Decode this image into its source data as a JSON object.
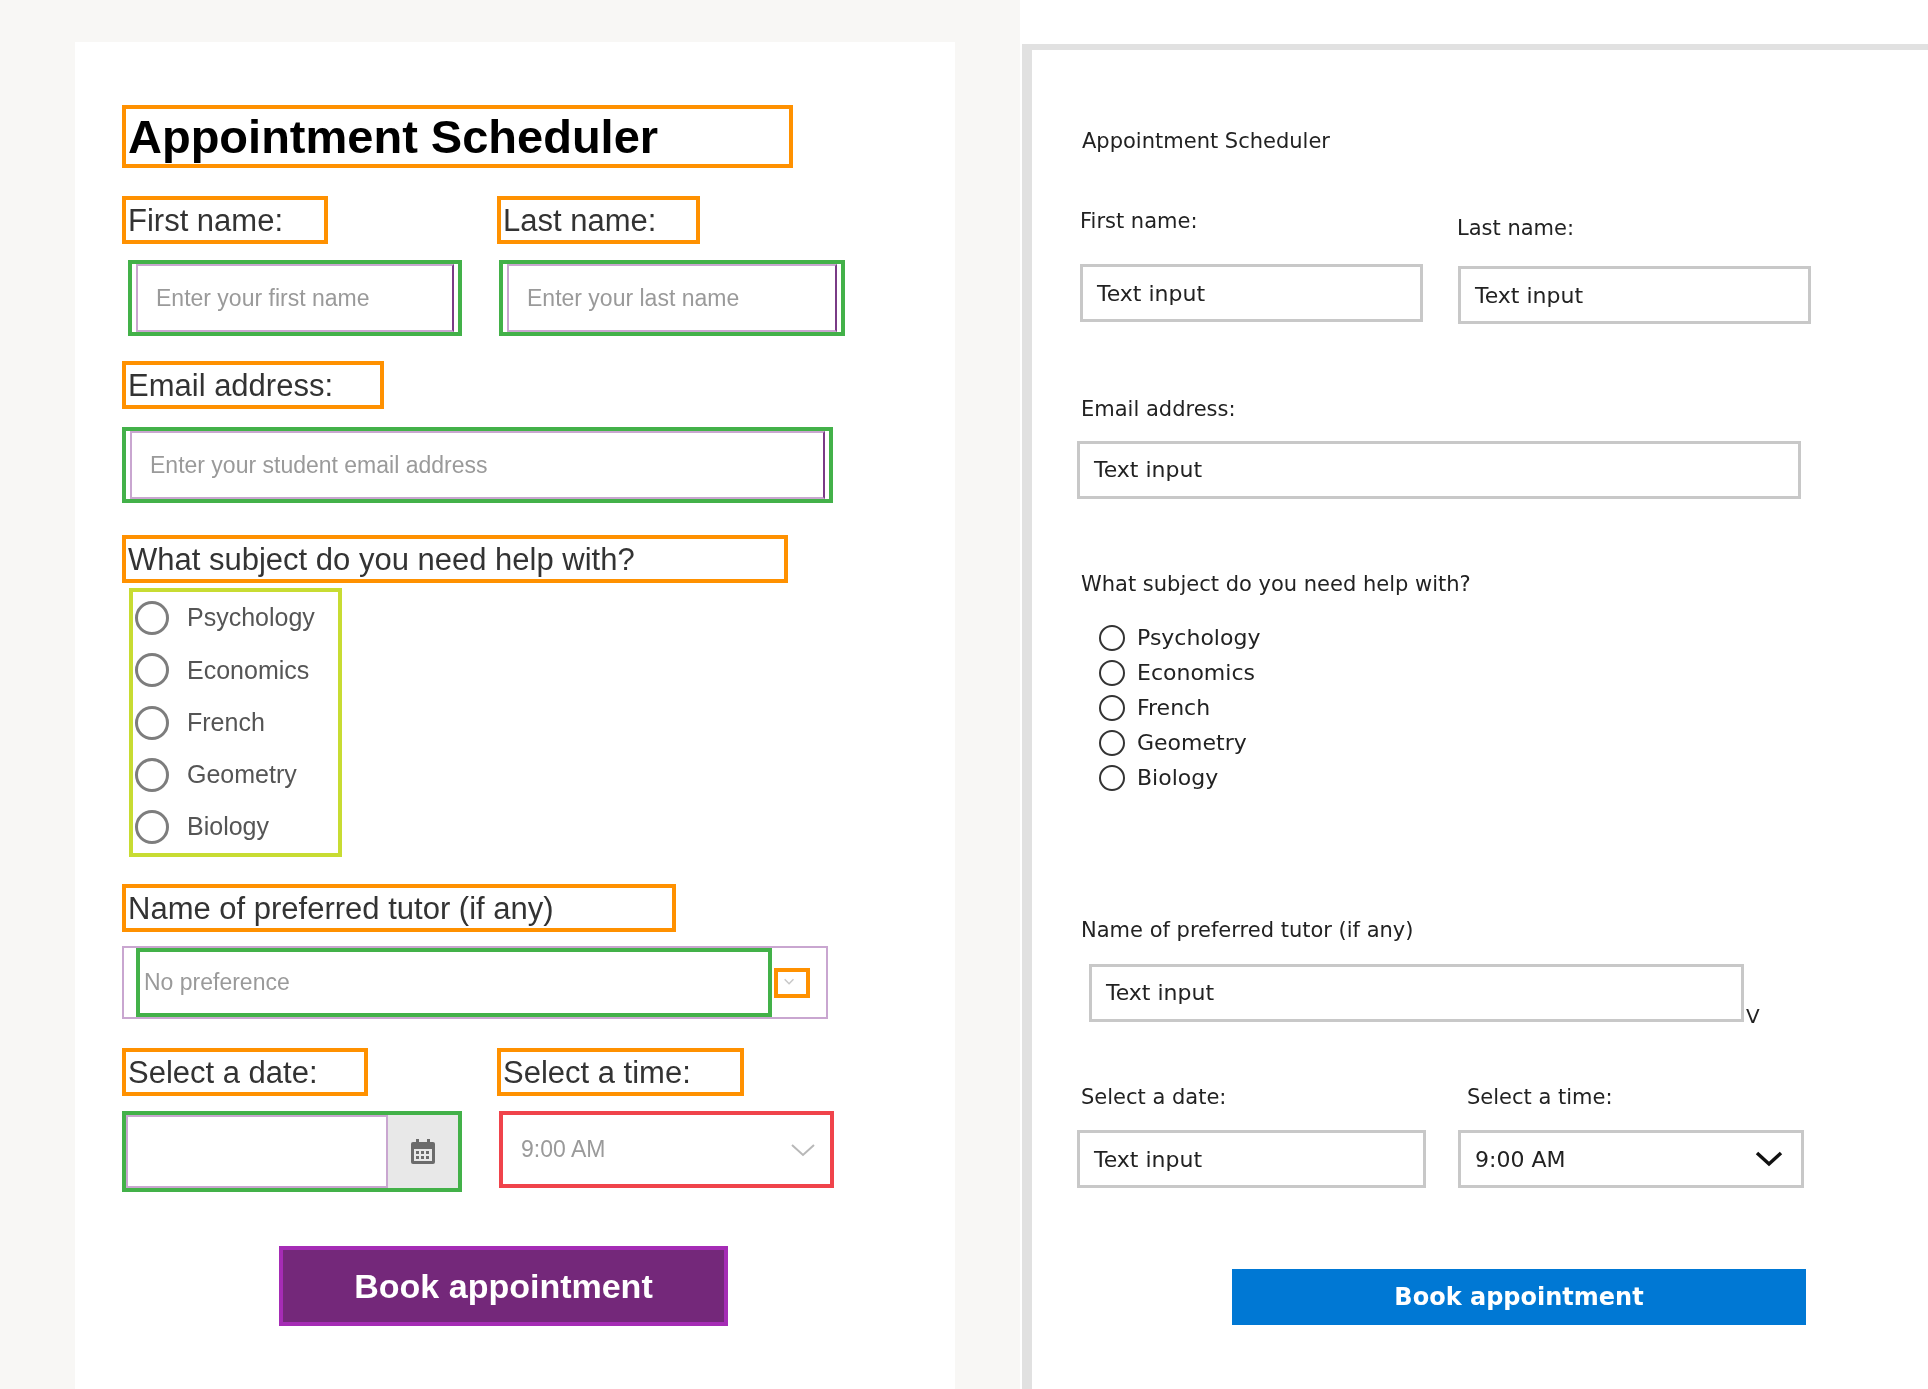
{
  "mockup": {
    "title": "Appointment Scheduler",
    "first_name": {
      "label": "First name:",
      "placeholder": "Enter your first name"
    },
    "last_name": {
      "label": "Last name:",
      "placeholder": "Enter your last name"
    },
    "email": {
      "label": "Email address:",
      "placeholder": "Enter your student email address"
    },
    "subject": {
      "question": "What subject do you need help with?",
      "options": [
        {
          "label": "Psychology",
          "selected": false
        },
        {
          "label": "Economics",
          "selected": false
        },
        {
          "label": "French",
          "selected": false
        },
        {
          "label": "Geometry",
          "selected": false
        },
        {
          "label": "Biology",
          "selected": false
        }
      ]
    },
    "tutor": {
      "label": "Name of preferred tutor (if any)",
      "placeholder": "No preference"
    },
    "date": {
      "label": "Select a date:"
    },
    "time": {
      "label": "Select a time:",
      "placeholder": "9:00 AM"
    },
    "button": "Book appointment"
  },
  "app_preview": {
    "title": "Appointment Scheduler",
    "first_name": {
      "label": "First name:",
      "value": "Text input"
    },
    "last_name": {
      "label": "Last name:",
      "value": "Text input"
    },
    "email": {
      "label": "Email address:",
      "value": "Text input"
    },
    "subject": {
      "question": "What subject do you need help with?",
      "options": [
        {
          "label": "Psychology",
          "selected": false
        },
        {
          "label": "Economics",
          "selected": false
        },
        {
          "label": "French",
          "selected": false
        },
        {
          "label": "Geometry",
          "selected": false
        },
        {
          "label": "Biology",
          "selected": false
        }
      ]
    },
    "tutor": {
      "label": "Name of preferred tutor (if any)",
      "value": "Text input",
      "marker": "V"
    },
    "date": {
      "label": "Select a date:",
      "value": "Text input"
    },
    "time": {
      "label": "Select a time:",
      "value": "9:00 AM"
    },
    "button": "Book appointment"
  }
}
